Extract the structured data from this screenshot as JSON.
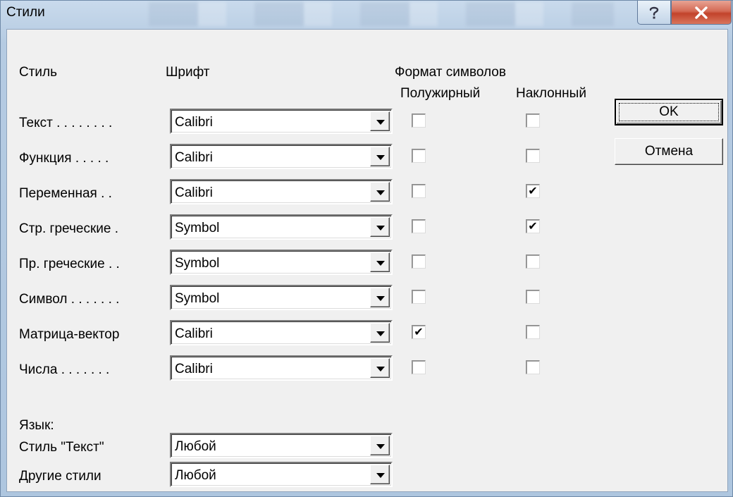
{
  "window": {
    "title": "Стили"
  },
  "headers": {
    "style": "Стиль",
    "font": "Шрифт",
    "format": "Формат символов",
    "bold": "Полужирный",
    "italic": "Наклонный"
  },
  "rows": [
    {
      "label": "Текст . . . . . . . .",
      "font": "Calibri",
      "bold": false,
      "italic": false
    },
    {
      "label": "Функция . . . . .",
      "font": "Calibri",
      "bold": false,
      "italic": false
    },
    {
      "label": "Переменная . .",
      "font": "Calibri",
      "bold": false,
      "italic": true
    },
    {
      "label": "Стр. греческие .",
      "font": "Symbol",
      "bold": false,
      "italic": true
    },
    {
      "label": "Пр. греческие . .",
      "font": "Symbol",
      "bold": false,
      "italic": false
    },
    {
      "label": "Символ . . . . . . .",
      "font": "Symbol",
      "bold": false,
      "italic": false
    },
    {
      "label": "Матрица-вектор",
      "font": "Calibri",
      "bold": true,
      "italic": false
    },
    {
      "label": "Числа . . . . . . .",
      "font": "Calibri",
      "bold": false,
      "italic": false
    }
  ],
  "language": {
    "heading": "Язык:",
    "text_style_label": "Стиль \"Текст\"",
    "text_style_value": "Любой",
    "other_styles_label": "Другие стили",
    "other_styles_value": "Любой"
  },
  "buttons": {
    "ok": "OK",
    "cancel": "Отмена"
  },
  "icons": {
    "help": "help-icon",
    "close": "close-icon",
    "check": "checkmark-icon"
  }
}
